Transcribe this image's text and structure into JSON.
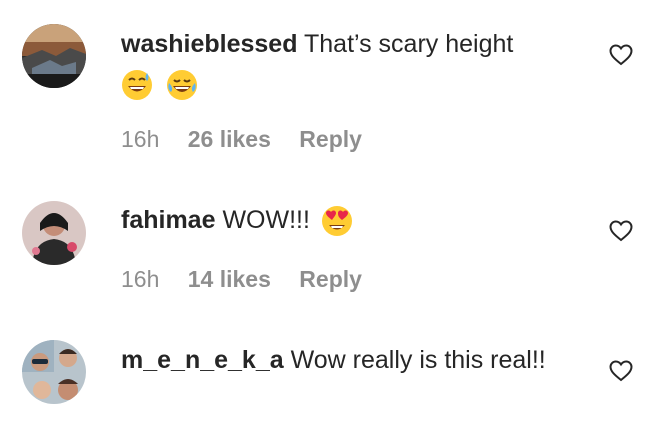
{
  "comments": [
    {
      "username": "washieblessed",
      "text": "That’s scary height",
      "emojis": [
        "grinning-sweat-emoji",
        "tears-of-joy-emoji"
      ],
      "time": "16h",
      "likes": "26 likes",
      "reply_label": "Reply"
    },
    {
      "username": "fahimae",
      "text": "WOW!!!",
      "emojis": [
        "heart-eyes-emoji"
      ],
      "time": "16h",
      "likes": "14 likes",
      "reply_label": "Reply"
    },
    {
      "username": "m_e_n_e_k_a",
      "text": "Wow really is this real!!",
      "emojis": [],
      "time": "",
      "likes": "",
      "reply_label": ""
    }
  ],
  "icons": {
    "like": "heart-outline-icon"
  },
  "colors": {
    "text": "#262626",
    "meta": "#8e8e8e",
    "background": "#ffffff"
  }
}
